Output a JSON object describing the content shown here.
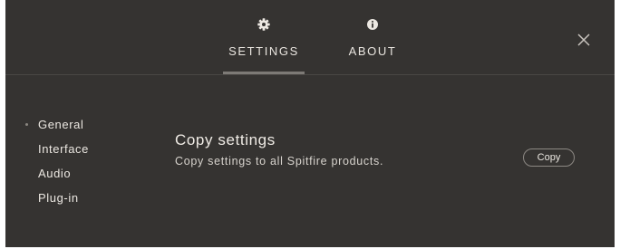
{
  "tabs": {
    "settings": {
      "label": "SETTINGS",
      "icon": "gear-icon",
      "active": true
    },
    "about": {
      "label": "ABOUT",
      "icon": "info-icon",
      "active": false
    }
  },
  "close": {
    "icon": "close-icon"
  },
  "sidebar": {
    "items": [
      {
        "label": "General",
        "selected": true
      },
      {
        "label": "Interface",
        "selected": false
      },
      {
        "label": "Audio",
        "selected": false
      },
      {
        "label": "Plug-in",
        "selected": false
      }
    ]
  },
  "content": {
    "title": "Copy settings",
    "description": "Copy settings to all Spitfire products.",
    "button_label": "Copy"
  },
  "colors": {
    "background": "#353331",
    "text": "#e6e2dc",
    "accent_underline": "#7d7a76",
    "divider": "#4a4744"
  }
}
